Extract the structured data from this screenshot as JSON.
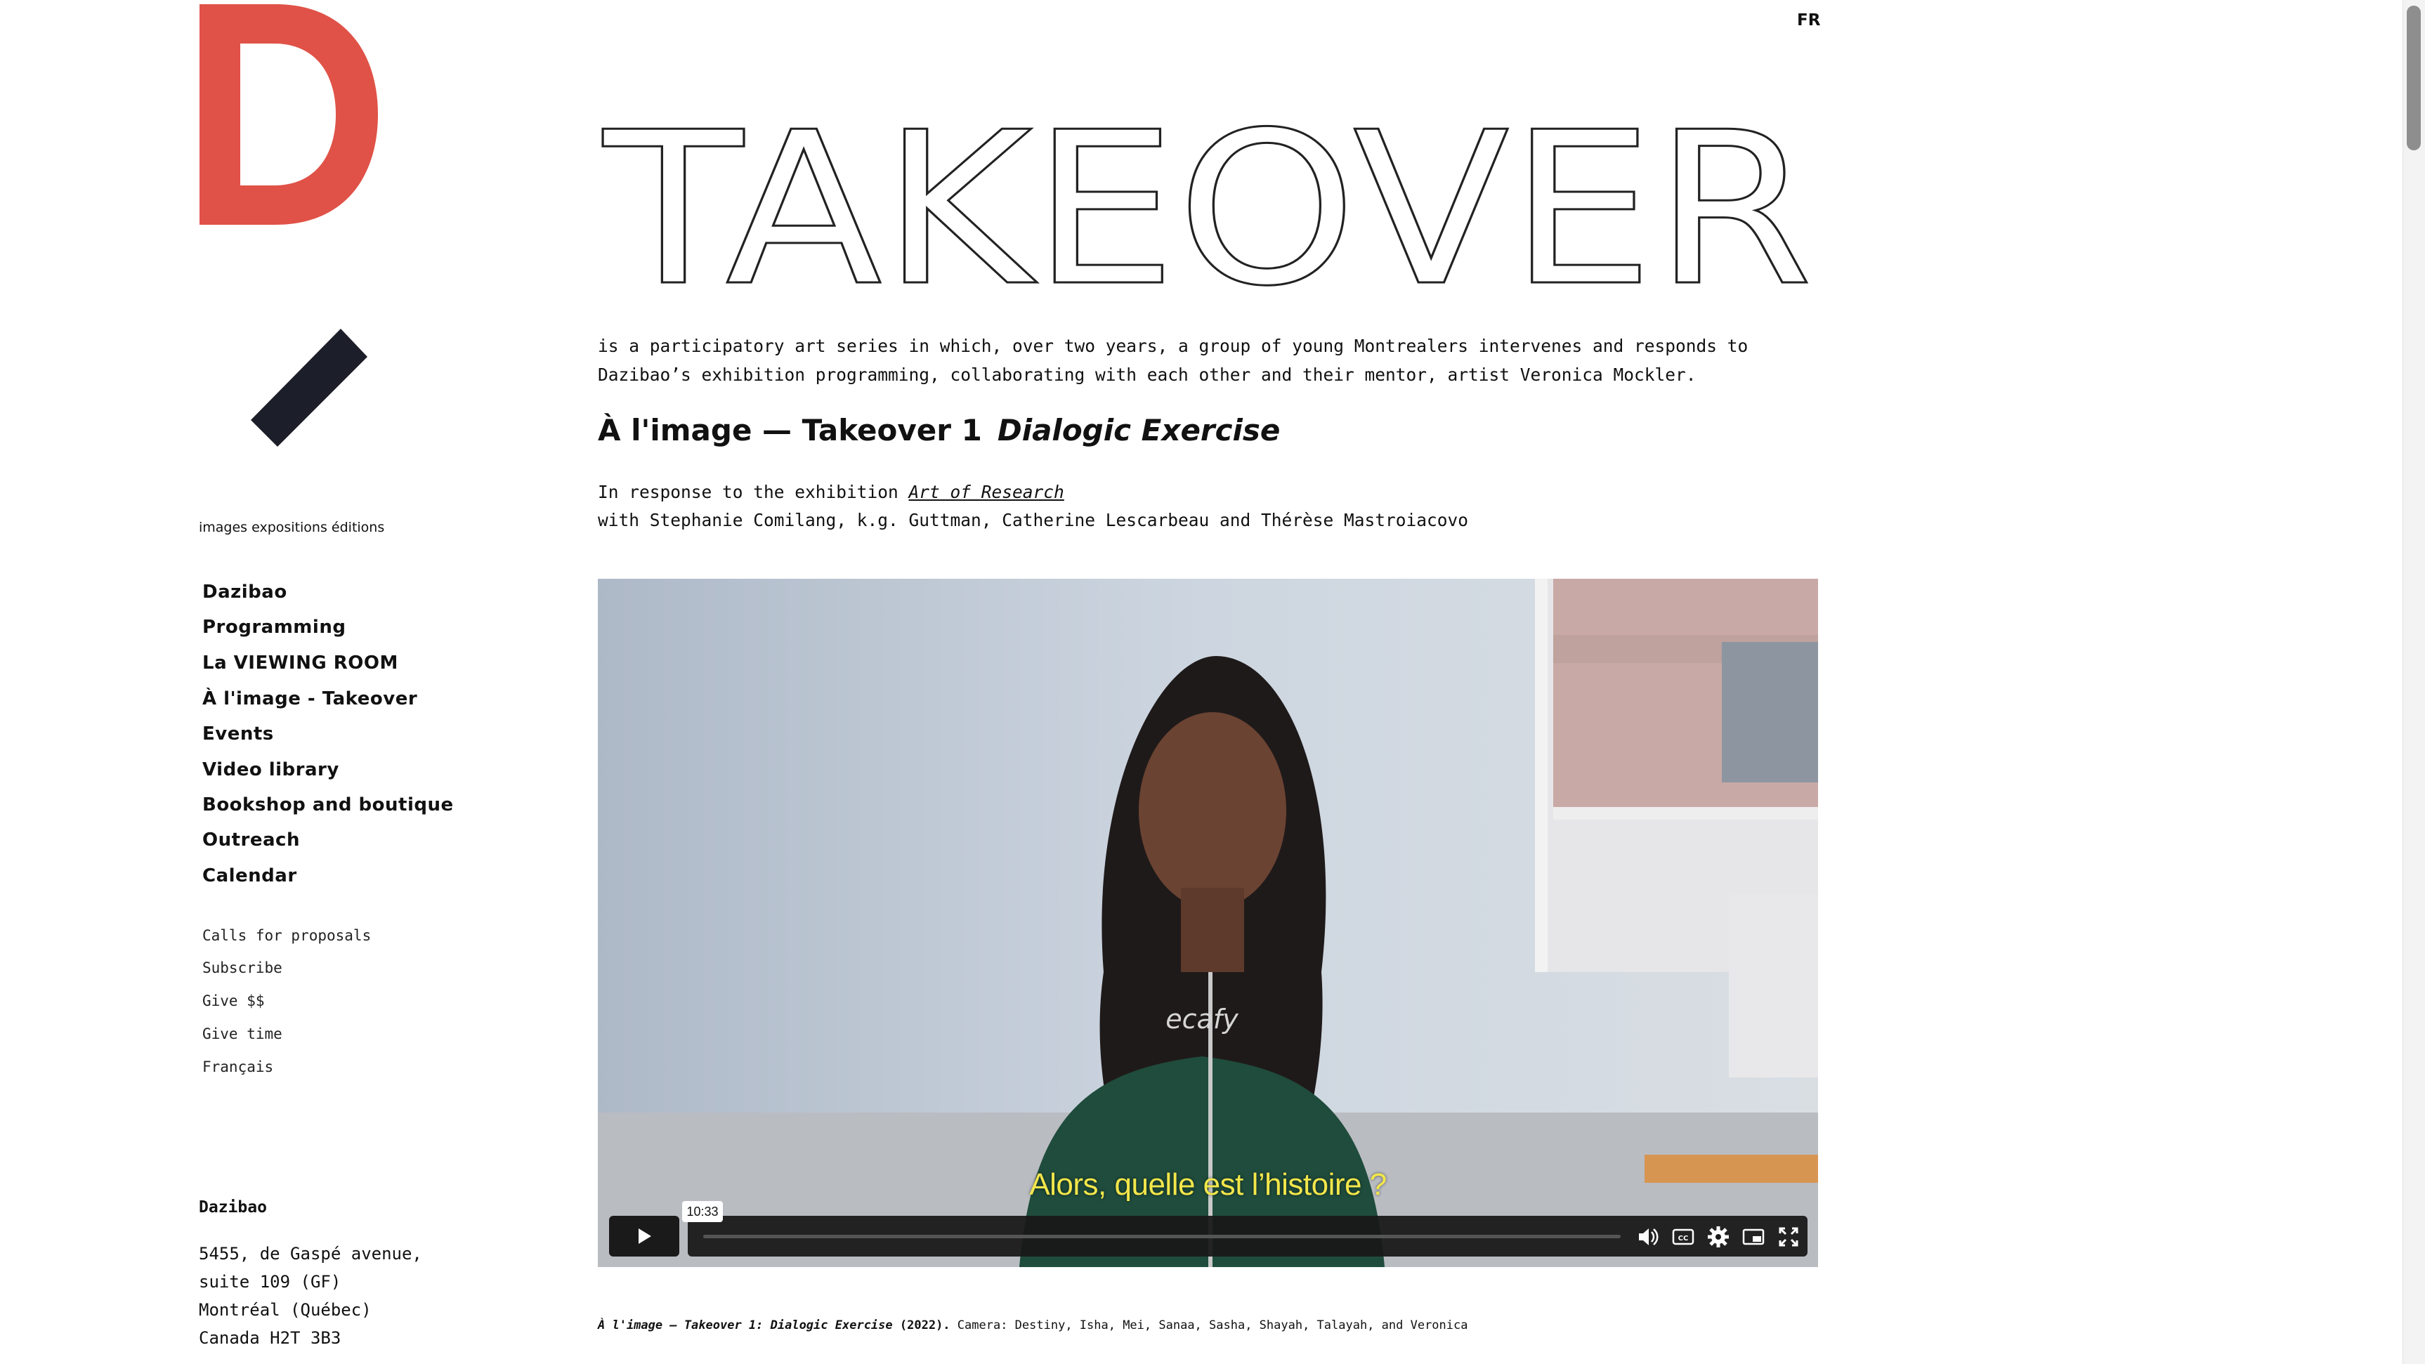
{
  "header": {
    "logo_letter": "D",
    "tagline": "images expositions éditions",
    "lang_switch": "FR"
  },
  "nav": {
    "main": [
      "Dazibao",
      "Programming",
      "La VIEWING ROOM",
      "À l'image - Takeover",
      "Events",
      "Video library",
      "Bookshop and boutique",
      "Outreach",
      "Calendar"
    ],
    "secondary": [
      "Calls for proposals",
      "Subscribe",
      "Give $$",
      "Give time",
      "Français"
    ]
  },
  "address": {
    "name": "Dazibao",
    "lines": [
      "5455, de Gaspé avenue,",
      "suite 109 (GF)",
      "Montréal (Québec)",
      "Canada H2T 3B3"
    ]
  },
  "content": {
    "title": "TAKEOVER",
    "intro": "is a participatory art series in which, over two years, a group of young Montrealers intervenes and responds to Dazibao’s exhibition programming, collaborating with each other and their mentor, artist Veronica Mockler.",
    "heading_main": "À l'image — Takeover 1",
    "heading_italic": "Dialogic Exercise",
    "response_prefix": "In response to the exhibition",
    "response_link": "Art of Research",
    "with_line": "with Stephanie Comilang, k.g. Guttman, Catherine Lescarbeau and Thérèse Mastroiacovo"
  },
  "video": {
    "subtitle": "Alors, quelle est l’histoire ?",
    "duration": "10:33",
    "progress": 0,
    "controls": [
      "play-icon",
      "volume-icon",
      "closed-captions-icon",
      "settings-icon",
      "picture-in-picture-icon",
      "fullscreen-icon"
    ]
  },
  "caption": {
    "title": "À l'image — Takeover 1: Dialogic Exercise",
    "year": "(2022).",
    "credits": "Camera: Destiny, Isha, Mei, Sanaa, Sasha, Shayah, Talayah, and Veronica"
  },
  "colors": {
    "logo_red": "#e05247",
    "slash_dark": "#1c1f2a",
    "subtitle_yellow": "#f2e64b",
    "controls_dark": "#1a1a1a"
  }
}
